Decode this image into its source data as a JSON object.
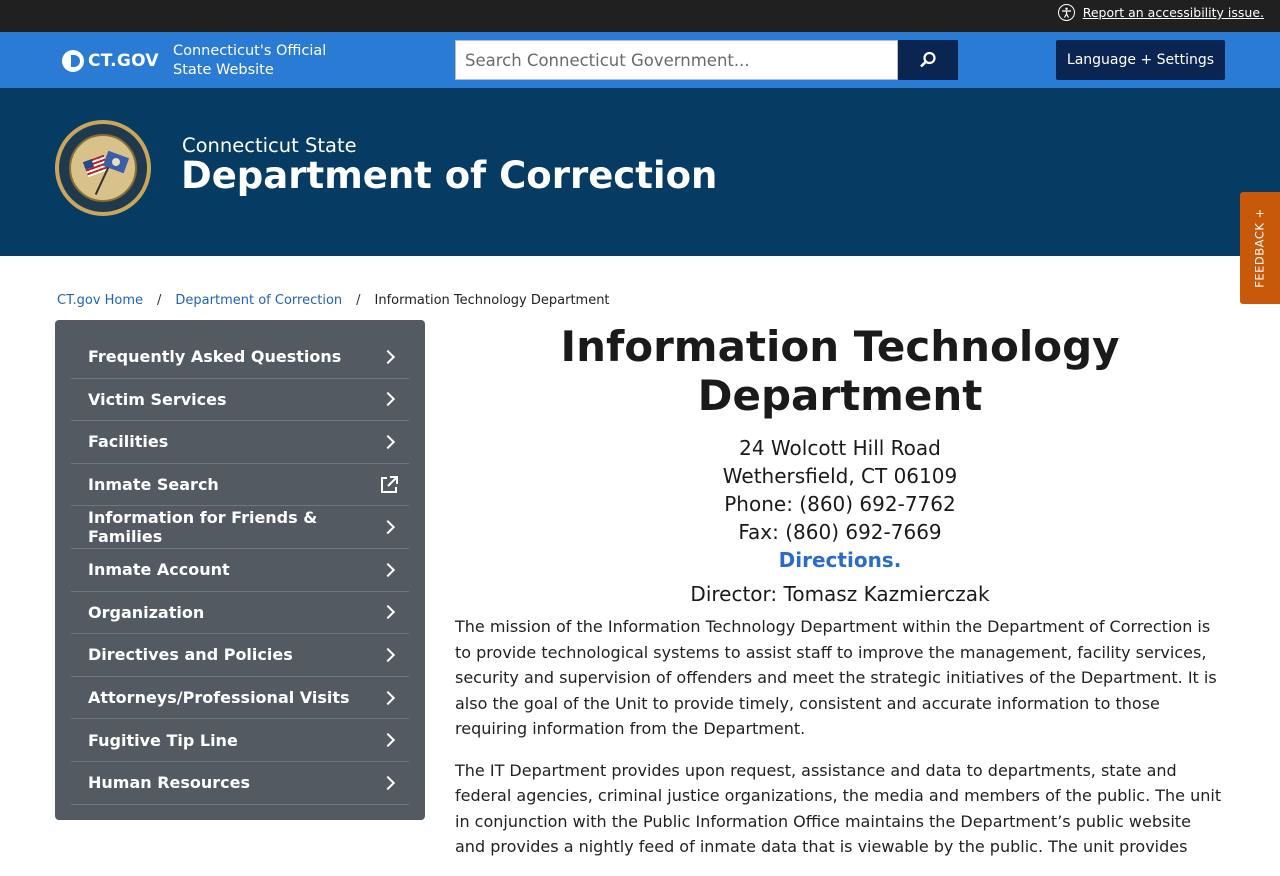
{
  "utility_bar": {
    "accessibility_link": "Report an accessibility issue."
  },
  "ctgov_bar": {
    "logo_text": "CT.GOV",
    "tagline": "Connecticut's Official State Website",
    "search_placeholder": "Search Connecticut Government...",
    "language_button": "Language + Settings"
  },
  "agency": {
    "subtitle": "Connecticut State",
    "title": "Department of Correction",
    "seal_text": "CONNECTICUT DEPARTMENT OF CORRECTION"
  },
  "feedback_tab": "FEEDBACK +",
  "breadcrumb": {
    "home": "CT.gov Home",
    "sep": "/",
    "dept": "Department of Correction",
    "current": "Information Technology Department"
  },
  "sidebar": {
    "items": [
      {
        "label": "Frequently Asked Questions",
        "icon": "chevron-right"
      },
      {
        "label": "Victim Services",
        "icon": "chevron-right"
      },
      {
        "label": "Facilities",
        "icon": "chevron-right"
      },
      {
        "label": "Inmate Search",
        "icon": "external-link"
      },
      {
        "label": "Information for Friends & Families",
        "icon": "chevron-right"
      },
      {
        "label": "Inmate Account",
        "icon": "chevron-right"
      },
      {
        "label": "Organization",
        "icon": "chevron-right"
      },
      {
        "label": "Directives and Policies",
        "icon": "chevron-right"
      },
      {
        "label": "Attorneys/Professional Visits",
        "icon": "chevron-right"
      },
      {
        "label": "Fugitive Tip Line",
        "icon": "chevron-right"
      },
      {
        "label": "Human Resources",
        "icon": "chevron-right"
      }
    ]
  },
  "main": {
    "title": "Information Technology Department",
    "address_line1": "24 Wolcott Hill Road",
    "address_line2": "Wethersfield, CT 06109",
    "phone": "Phone: (860) 692-7762",
    "fax": "Fax: (860) 692-7669",
    "directions": "Directions.",
    "director": "Director: Tomasz Kazmierczak",
    "paragraph1": "The mission of the Information Technology Department within the Department of Correction is to provide technological systems to assist staff to improve the management, facility services, security and supervision of offenders and meet the strategic initiatives of the Department. It is also the goal of the Unit to provide timely, consistent and accurate information to those requiring information from the Department.",
    "paragraph2": "The IT Department provides upon request, assistance and data to departments, state and federal agencies, criminal justice organizations, the media and members of the public. The unit in conjunction with the Public Information Office maintains the Department’s public website and provides a nightly feed of inmate data that is viewable by the public. The unit provides"
  },
  "colors": {
    "topbar": "#202020",
    "ctgov_blue": "#2a7bd4",
    "navy_button": "#0b2553",
    "agency_header": "#063c63",
    "sidebar": "#535a61",
    "feedback": "#c9590a",
    "link": "#2a6cc7"
  }
}
